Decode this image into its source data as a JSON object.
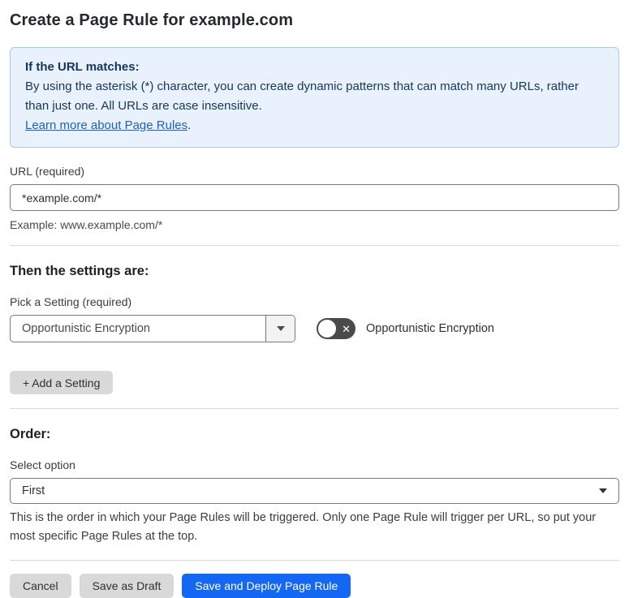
{
  "page": {
    "title": "Create a Page Rule for example.com"
  },
  "info_box": {
    "heading": "If the URL matches:",
    "body": "By using the asterisk (*) character, you can create dynamic patterns that can match many URLs, rather than just one. All URLs are case insensitive.",
    "link_label": "Learn more about Page Rules",
    "link_suffix": "."
  },
  "url_section": {
    "label": "URL (required)",
    "value": "*example.com/*",
    "example": "Example: www.example.com/*"
  },
  "settings_section": {
    "heading": "Then the settings are:",
    "picker_label": "Pick a Setting (required)",
    "picker_value": "Opportunistic Encryption",
    "toggle_state": "off",
    "toggle_icon": "x-icon",
    "toggle_label": "Opportunistic Encryption",
    "add_setting_label": "+ Add a Setting"
  },
  "order_section": {
    "heading": "Order:",
    "select_label": "Select option",
    "select_value": "First",
    "help_text": "This is the order in which your Page Rules will be triggered. Only one Page Rule will trigger per URL, so put your most specific Page Rules at the top."
  },
  "footer": {
    "cancel_label": "Cancel",
    "save_draft_label": "Save as Draft",
    "save_deploy_label": "Save and Deploy Page Rule"
  },
  "colors": {
    "primary_blue": "#1467f2",
    "info_background": "#e9f2fc",
    "info_border": "#a9c9e8",
    "info_text": "#16355d",
    "link_blue": "#1d5fcc",
    "button_gray": "#d9d9d9",
    "toggle_dark": "#4a4a4a",
    "border_gray": "#797979"
  }
}
